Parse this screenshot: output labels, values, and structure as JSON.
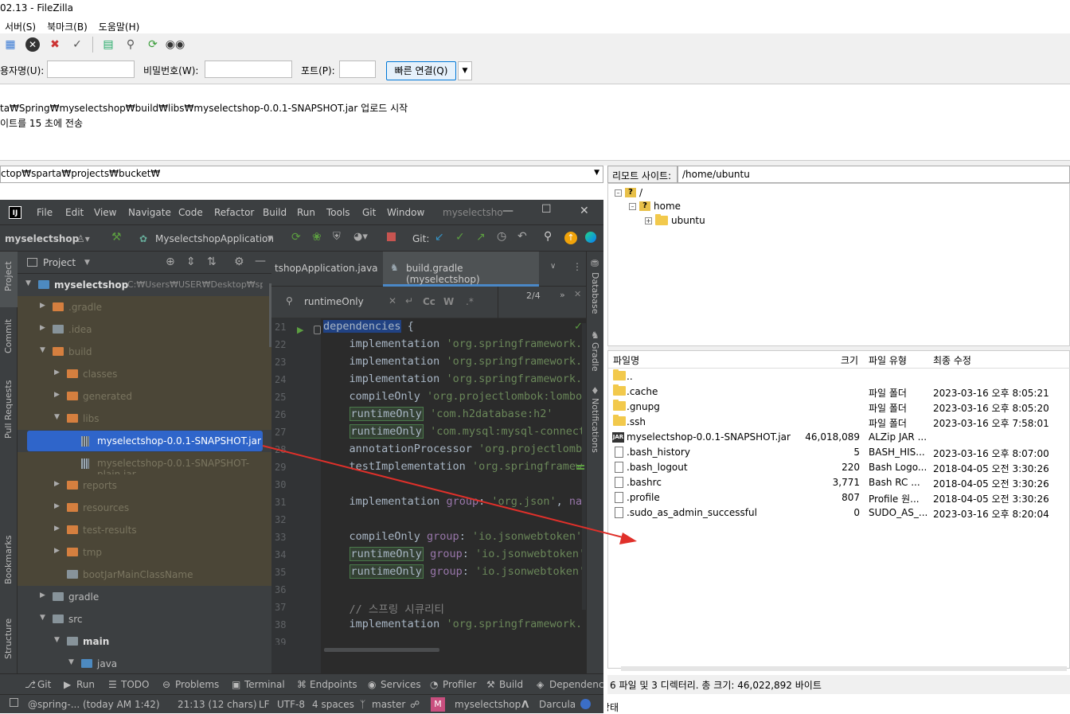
{
  "filezilla": {
    "title": "02.13 - FileZilla",
    "menu": [
      "서버(S)",
      "북마크(B)",
      "도움말(H)"
    ],
    "quickconnect": {
      "user_label": "용자명(U):",
      "user_value": "",
      "pass_label": "비밀번호(W):",
      "pass_value": "",
      "port_label": "포트(P):",
      "port_value": "",
      "connect_label": "빠른 연결(Q)"
    },
    "log": [
      "ta₩Spring₩myselectshop₩build₩libs₩myselectshop-0.0.1-SNAPSHOT.jar 업로드 시작",
      "이트를 15 초에 전송"
    ],
    "local_path": "ctop₩sparta₩projects₩bucket₩",
    "remote_label": "리모트 사이트:",
    "remote_path": "/home/ubuntu",
    "remote_tree": {
      "root": "/",
      "home": "home",
      "ubuntu": "ubuntu"
    },
    "columns": {
      "name": "파일명",
      "size": "크기",
      "type": "파일 유형",
      "modified": "최종 수정"
    },
    "files": [
      {
        "name": "..",
        "size": "",
        "type": "",
        "modified": "",
        "kind": "folder"
      },
      {
        "name": ".cache",
        "size": "",
        "type": "파일 폴더",
        "modified": "2023-03-16 오후 8:05:21",
        "kind": "folder"
      },
      {
        "name": ".gnupg",
        "size": "",
        "type": "파일 폴더",
        "modified": "2023-03-16 오후 8:05:20",
        "kind": "folder"
      },
      {
        "name": ".ssh",
        "size": "",
        "type": "파일 폴더",
        "modified": "2023-03-16 오후 7:58:01",
        "kind": "folder"
      },
      {
        "name": "myselectshop-0.0.1-SNAPSHOT.jar",
        "size": "46,018,089",
        "type": "ALZip JAR ...",
        "modified": "",
        "kind": "jar"
      },
      {
        "name": ".bash_history",
        "size": "5",
        "type": "BASH_HIS...",
        "modified": "2023-03-16 오후 8:07:00",
        "kind": "file"
      },
      {
        "name": ".bash_logout",
        "size": "220",
        "type": "Bash Logo...",
        "modified": "2018-04-05 오전 3:30:26",
        "kind": "file"
      },
      {
        "name": ".bashrc",
        "size": "3,771",
        "type": "Bash RC ...",
        "modified": "2018-04-05 오전 3:30:26",
        "kind": "file"
      },
      {
        "name": ".profile",
        "size": "807",
        "type": "Profile 원...",
        "modified": "2018-04-05 오전 3:30:26",
        "kind": "file"
      },
      {
        "name": ".sudo_as_admin_successful",
        "size": "0",
        "type": "SUDO_AS_...",
        "modified": "2023-03-16 오후 8:20:04",
        "kind": "file"
      }
    ],
    "remote_status": "6 파일 및 3 디렉터리. 총 크기: 46,022,892 바이트",
    "bottom_text": "상태"
  },
  "intellij": {
    "menu": [
      "File",
      "Edit",
      "View",
      "Navigate",
      "Code",
      "Refactor",
      "Build",
      "Run",
      "Tools",
      "Git",
      "Window"
    ],
    "project_short": "myselectsho",
    "project_name": "myselectshop",
    "run_config": "MyselectshopApplication",
    "git_label": "Git:",
    "left_tabs": [
      "Project",
      "Commit",
      "Pull Requests",
      "Bookmarks",
      "Structure"
    ],
    "right_tabs": [
      "Database",
      "Gradle",
      "Notifications"
    ],
    "panel_title": "Project",
    "tree": [
      {
        "label": "myselectshop",
        "extra": "C:₩Users₩USER₩Desktop₩sparta₩",
        "indent": 0,
        "arrow": "▼",
        "icon": "b",
        "bold": true
      },
      {
        "label": ".gradle",
        "indent": 1,
        "arrow": "▶",
        "icon": "o",
        "excluded": true
      },
      {
        "label": ".idea",
        "indent": 1,
        "arrow": "▶",
        "icon": "g",
        "excluded": true
      },
      {
        "label": "build",
        "indent": 1,
        "arrow": "▼",
        "icon": "o",
        "excluded": true
      },
      {
        "label": "classes",
        "indent": 2,
        "arrow": "▶",
        "icon": "o",
        "excluded": true
      },
      {
        "label": "generated",
        "indent": 2,
        "arrow": "▶",
        "icon": "o",
        "excluded": true
      },
      {
        "label": "libs",
        "indent": 2,
        "arrow": "▼",
        "icon": "o",
        "excluded": true
      },
      {
        "label": "myselectshop-0.0.1-SNAPSHOT.jar",
        "indent": 3,
        "arrow": "",
        "icon": "jar",
        "selected": true
      },
      {
        "label": "myselectshop-0.0.1-SNAPSHOT-plain.jar",
        "indent": 3,
        "arrow": "",
        "icon": "jar",
        "excluded": true
      },
      {
        "label": "reports",
        "indent": 2,
        "arrow": "▶",
        "icon": "o",
        "excluded": true
      },
      {
        "label": "resources",
        "indent": 2,
        "arrow": "▶",
        "icon": "o",
        "excluded": true
      },
      {
        "label": "test-results",
        "indent": 2,
        "arrow": "▶",
        "icon": "o",
        "excluded": true
      },
      {
        "label": "tmp",
        "indent": 2,
        "arrow": "▶",
        "icon": "o",
        "excluded": true
      },
      {
        "label": "bootJarMainClassName",
        "indent": 2,
        "arrow": "",
        "icon": "g",
        "excluded": true
      },
      {
        "label": "gradle",
        "indent": 1,
        "arrow": "▶",
        "icon": "g"
      },
      {
        "label": "src",
        "indent": 1,
        "arrow": "▼",
        "icon": "g"
      },
      {
        "label": "main",
        "indent": 2,
        "arrow": "▼",
        "icon": "g",
        "bold": true
      },
      {
        "label": "java",
        "indent": 3,
        "arrow": "▼",
        "icon": "b"
      }
    ],
    "tabs": [
      "tshopApplication.java",
      "build.gradle (myselectshop)"
    ],
    "search": {
      "query": "runtimeOnly",
      "count": "2/4"
    },
    "code": [
      {
        "n": "21",
        "t": [
          [
            "kw",
            "dependencies"
          ],
          [
            "p",
            " {"
          ]
        ]
      },
      {
        "n": "22",
        "t": [
          [
            "p",
            "    implementation "
          ],
          [
            "str",
            "'org.springframework.bo"
          ]
        ]
      },
      {
        "n": "23",
        "t": [
          [
            "p",
            "    implementation "
          ],
          [
            "str",
            "'org.springframework.bo"
          ]
        ]
      },
      {
        "n": "24",
        "t": [
          [
            "p",
            "    implementation "
          ],
          [
            "str",
            "'org.springframework.bo"
          ]
        ]
      },
      {
        "n": "25",
        "t": [
          [
            "p",
            "    compileOnly "
          ],
          [
            "str",
            "'org.projectlombok:lombok"
          ]
        ]
      },
      {
        "n": "26",
        "t": [
          [
            "p",
            "    "
          ],
          [
            "hl",
            "runtimeOnly"
          ],
          [
            "p",
            " "
          ],
          [
            "str",
            "'com.h2database:h2'"
          ]
        ]
      },
      {
        "n": "27",
        "t": [
          [
            "p",
            "    "
          ],
          [
            "hl",
            "runtimeOnly"
          ],
          [
            "p",
            " "
          ],
          [
            "str",
            "'com.mysql:mysql-connecto"
          ]
        ]
      },
      {
        "n": "28",
        "t": [
          [
            "p",
            "    annotationProcessor "
          ],
          [
            "str",
            "'org.projectlombo"
          ]
        ]
      },
      {
        "n": "29",
        "t": [
          [
            "p",
            "    testImplementation "
          ],
          [
            "str",
            "'org.springframewo"
          ]
        ]
      },
      {
        "n": "30",
        "t": []
      },
      {
        "n": "31",
        "t": [
          [
            "p",
            "    implementation "
          ],
          [
            "gr",
            "group"
          ],
          [
            "p",
            ": "
          ],
          [
            "str",
            "'org.json'"
          ],
          [
            "p",
            ", "
          ],
          [
            "gr",
            "name"
          ]
        ]
      },
      {
        "n": "32",
        "t": []
      },
      {
        "n": "33",
        "t": [
          [
            "p",
            "    compileOnly "
          ],
          [
            "gr",
            "group"
          ],
          [
            "p",
            ": "
          ],
          [
            "str",
            "'io.jsonwebtoken'"
          ],
          [
            "p",
            ","
          ]
        ]
      },
      {
        "n": "34",
        "t": [
          [
            "p",
            "    "
          ],
          [
            "hl",
            "runtimeOnly"
          ],
          [
            "p",
            " "
          ],
          [
            "gr",
            "group"
          ],
          [
            "p",
            ": "
          ],
          [
            "str",
            "'io.jsonwebtoken'"
          ],
          [
            "p",
            ","
          ]
        ]
      },
      {
        "n": "35",
        "t": [
          [
            "p",
            "    "
          ],
          [
            "hl",
            "runtimeOnly"
          ],
          [
            "p",
            " "
          ],
          [
            "gr",
            "group"
          ],
          [
            "p",
            ": "
          ],
          [
            "str",
            "'io.jsonwebtoken'"
          ],
          [
            "p",
            ","
          ]
        ]
      },
      {
        "n": "36",
        "t": []
      },
      {
        "n": "37",
        "t": [
          [
            "cm",
            "    // 스프링 시큐리티"
          ]
        ]
      },
      {
        "n": "38",
        "t": [
          [
            "p",
            "    implementation "
          ],
          [
            "str",
            "'org.springframework.bo"
          ]
        ]
      },
      {
        "n": "39",
        "t": []
      }
    ],
    "bottom_tools": [
      "Git",
      "Run",
      "TODO",
      "Problems",
      "Terminal",
      "Endpoints",
      "Services",
      "Profiler",
      "Build",
      "Dependencies"
    ],
    "status": {
      "commit": "@spring-... (today AM 1:42)",
      "position": "21:13 (12 chars)",
      "line_sep": "LF",
      "encoding": "UTF-8",
      "indent": "4 spaces",
      "branch": "master",
      "project": "myselectshop",
      "theme": "Darcula"
    }
  },
  "colors": {
    "selection": "#2f65ca",
    "arrow": "#e0302a",
    "editor_bg": "#2b2b2b",
    "ide_bg": "#3c3f41"
  }
}
